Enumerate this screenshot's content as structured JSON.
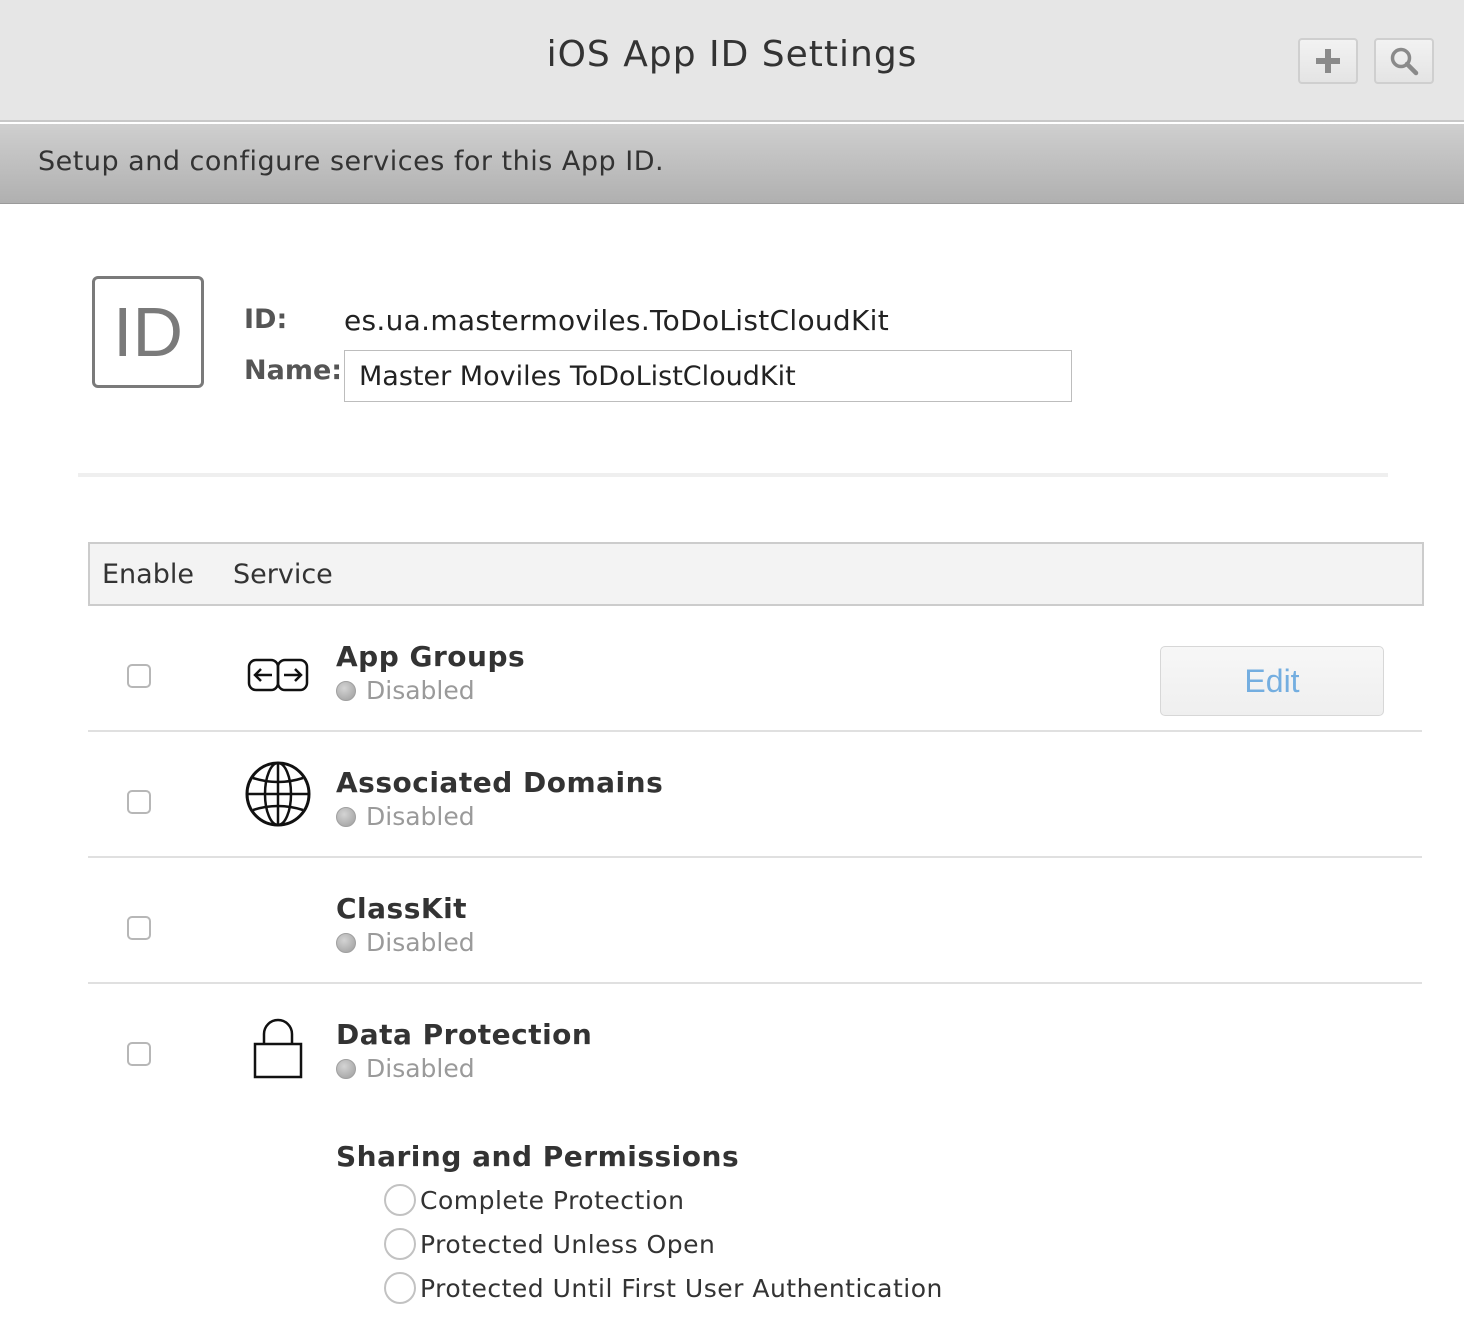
{
  "header": {
    "title": "iOS App ID Settings",
    "add_icon": "plus-icon",
    "search_icon": "search-icon"
  },
  "subheader": {
    "text": "Setup and configure services for this App ID."
  },
  "app": {
    "badge_text": "ID",
    "id_label": "ID:",
    "id_value": "es.ua.mastermoviles.ToDoListCloudKit",
    "name_label": "Name:",
    "name_value": "Master Moviles ToDoListCloudKit"
  },
  "table": {
    "col_enable": "Enable",
    "col_service": "Service"
  },
  "services": [
    {
      "name": "App Groups",
      "status": "Disabled",
      "icon": "app-groups-icon",
      "enabled": false,
      "edit_label": "Edit"
    },
    {
      "name": "Associated Domains",
      "status": "Disabled",
      "icon": "globe-icon",
      "enabled": false
    },
    {
      "name": "ClassKit",
      "status": "Disabled",
      "icon": "",
      "enabled": false
    },
    {
      "name": "Data Protection",
      "status": "Disabled",
      "icon": "lock-icon",
      "enabled": false
    }
  ],
  "data_protection": {
    "section_title": "Sharing and Permissions",
    "options": [
      "Complete Protection",
      "Protected Unless Open",
      "Protected Until First User Authentication"
    ]
  },
  "colors": {
    "edit_text": "#74aee0",
    "header_bg": "#e6e6e6",
    "subheader_bg": "#b8b8b8"
  }
}
